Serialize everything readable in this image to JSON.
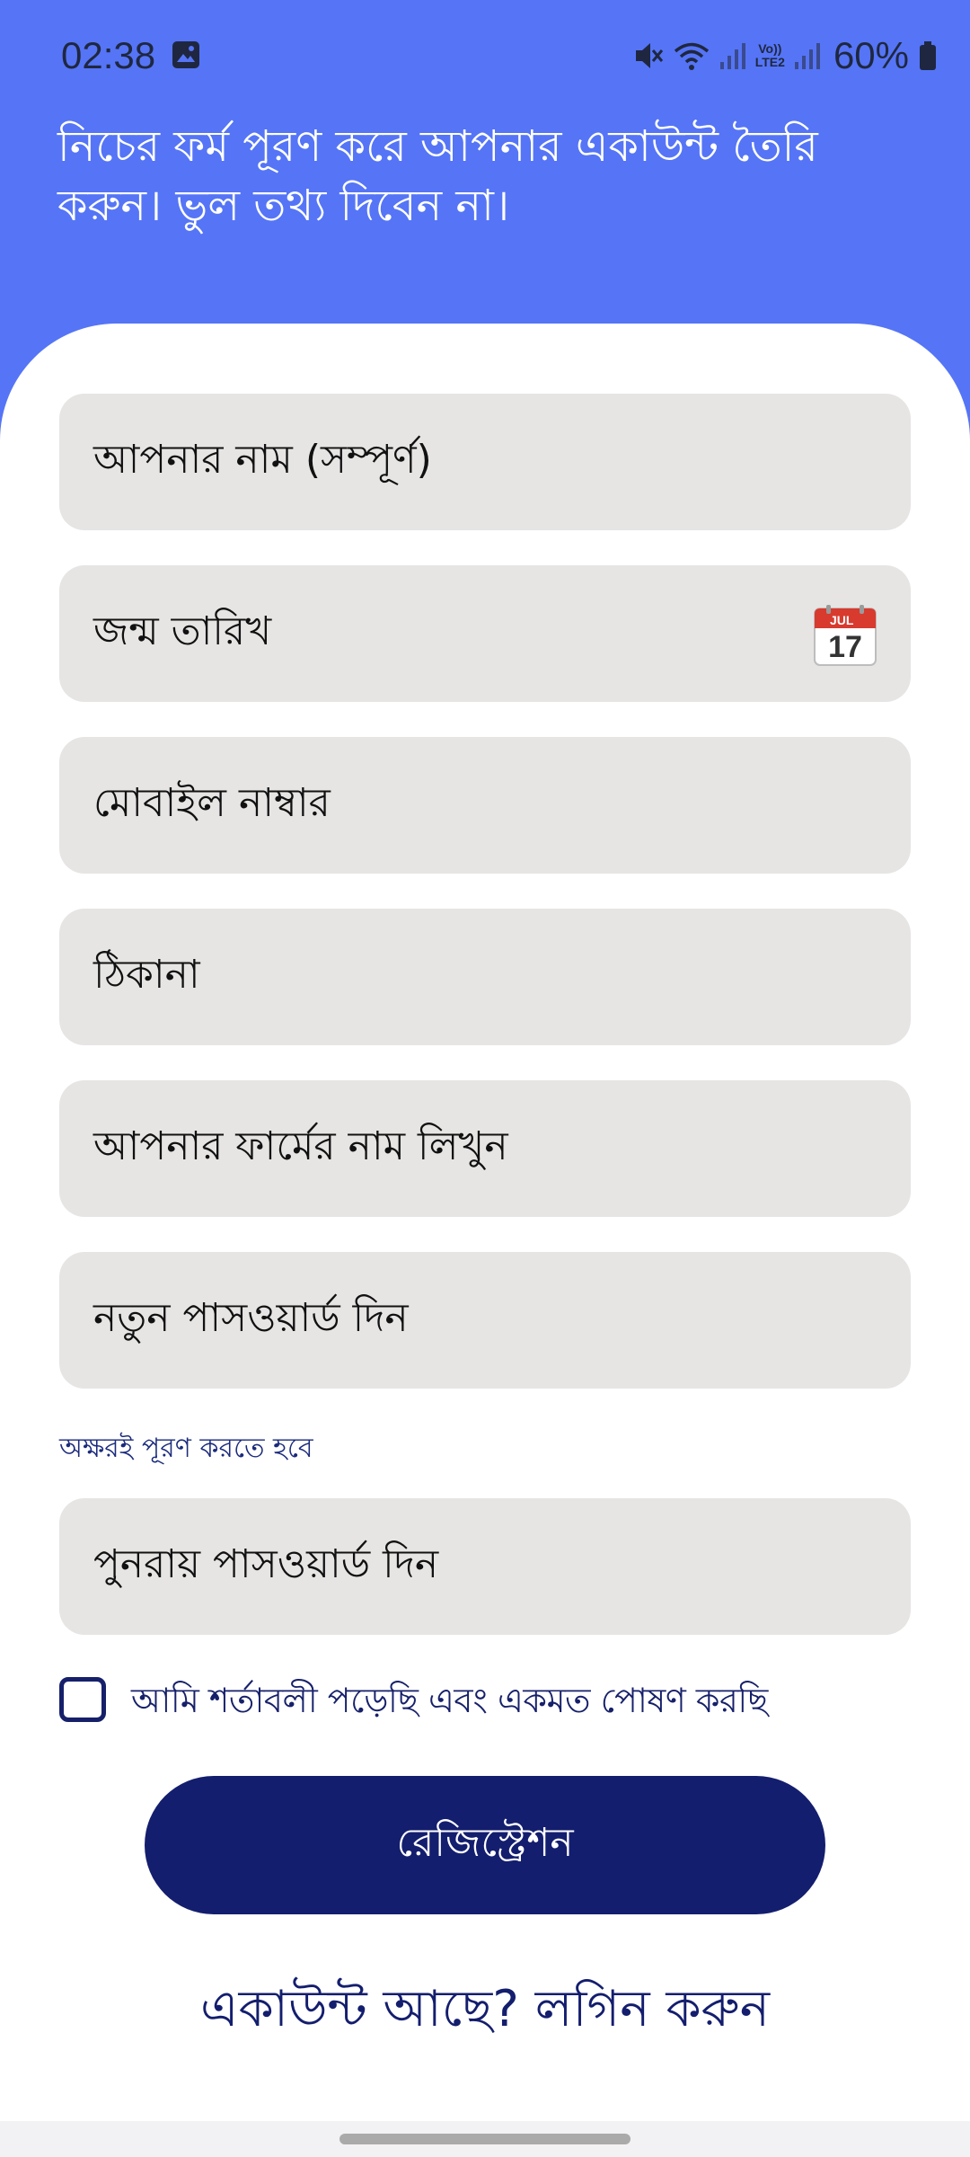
{
  "status_bar": {
    "time": "02:38",
    "network_label_top": "Vo))",
    "network_label_bottom": "LTE2",
    "battery": "60%"
  },
  "header": {
    "instruction": "নিচের ফর্ম পূরণ করে আপনার একাউন্ট তৈরি করুন। ভুল তথ্য দিবেন না।"
  },
  "form": {
    "full_name": "আপনার নাম (সম্পূর্ণ)",
    "birth_date": "জন্ম তারিখ",
    "calendar_month": "JUL",
    "calendar_day": "17",
    "mobile": "মোবাইল নাম্বার",
    "address": "ঠিকানা",
    "farm_name": "আপনার ফার্মের নাম লিখুন",
    "new_password": "নতুন পাসওয়ার্ড দিন",
    "password_hint": "অক্ষরই পূরণ করতে হবে",
    "confirm_password": "পুনরায় পাসওয়ার্ড দিন",
    "terms": "আমি শর্তাবলী পড়েছি এবং একমত পোষণ করছি",
    "terms_checked": false,
    "register_button": "রেজিস্ট্রেশন",
    "login_link": "একাউন্ট আছে? লগিন করুন"
  },
  "colors": {
    "header_bg": "#5575f6",
    "primary": "#141e6e",
    "field_bg": "#e6e5e4"
  }
}
